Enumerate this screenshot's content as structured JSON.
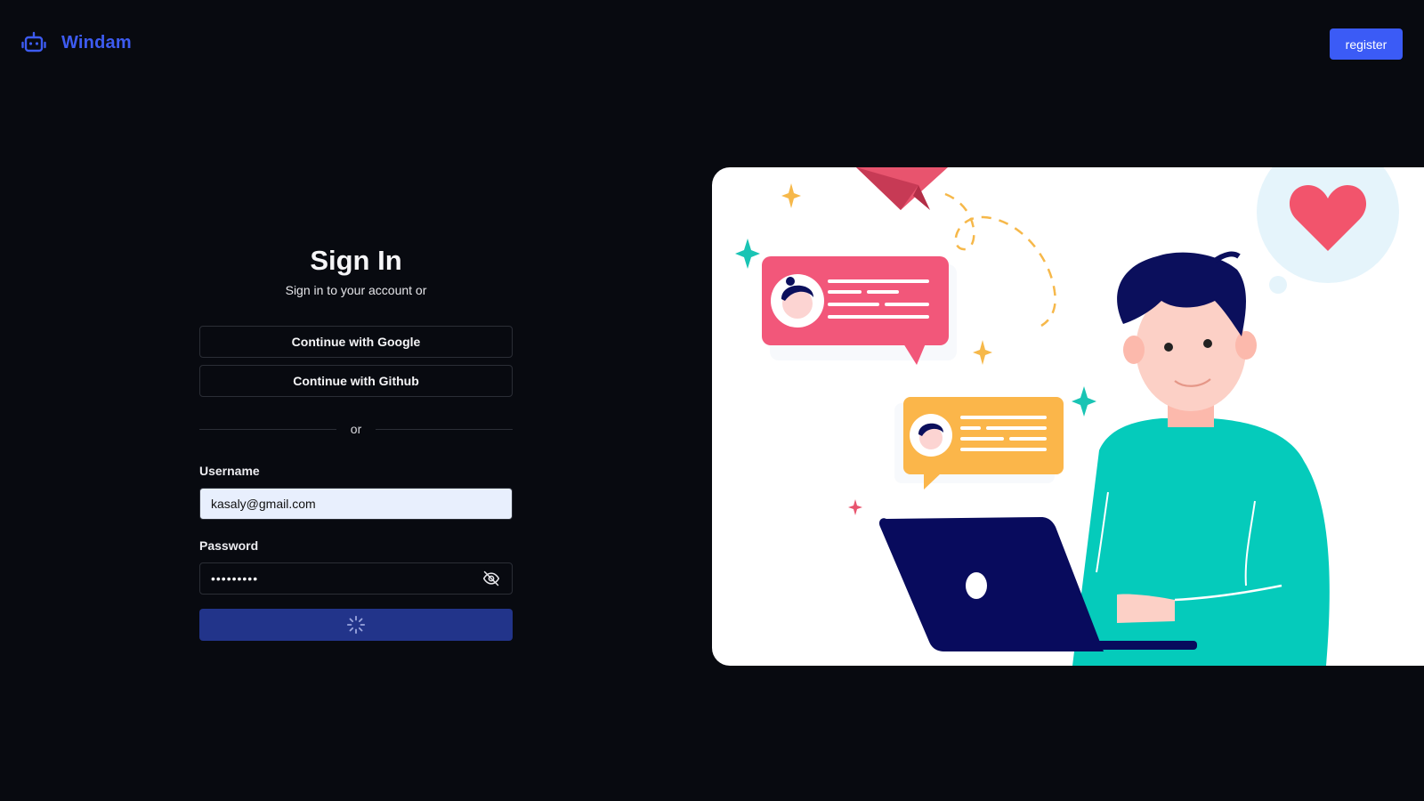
{
  "brand": {
    "name": "Windam",
    "icon": "robot-icon",
    "color": "#3d5bf0"
  },
  "header": {
    "register_label": "register"
  },
  "signin": {
    "title": "Sign In",
    "subtitle": "Sign in to your account or",
    "google_label": "Continue with Google",
    "github_label": "Continue with Github",
    "divider_text": "or",
    "username_label": "Username",
    "username_value": "kasaly@gmail.com",
    "password_label": "Password",
    "password_value": "123456789",
    "password_toggle_icon": "eye-off-icon",
    "submit_state": "loading",
    "submit_icon": "spinner-icon"
  },
  "hero": {
    "illustration": "person-chatting-on-laptop-illustration"
  },
  "colors": {
    "background": "#080a10",
    "accent": "#3b5bf6",
    "submit_loading": "#22348a",
    "username_fill": "#e8effd"
  }
}
